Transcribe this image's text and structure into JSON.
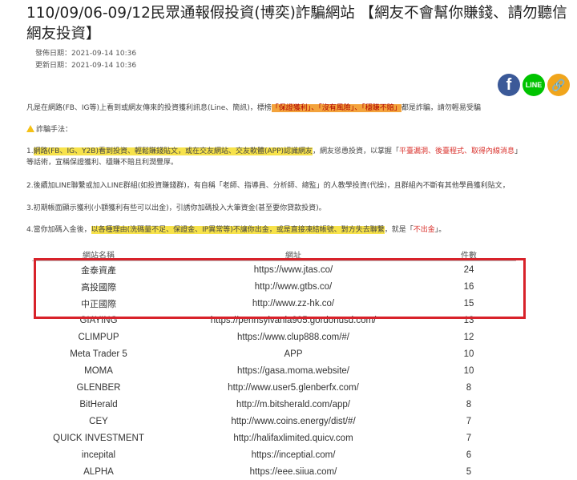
{
  "article": {
    "title": "110/09/06-09/12民眾通報假投資(博奕)詐騙網站 【網友不會幫你賺錢、請勿聽信網友投資】",
    "published": "發佈日期：2021-09-14 10:36",
    "updated": "更新日期：2021-09-14 10:36"
  },
  "share": {
    "facebook": "f",
    "line": "LINE",
    "link": "🔗"
  },
  "intro": {
    "before": "凡是在網路(FB、IG等)上看到或網友傳來的投資獲利訊息(Line、簡訊)，標榜",
    "hl1": "「保證獲利」、「沒有風險」、「穩賺不賠」",
    "after": "都是詐騙，請勿輕易受騙"
  },
  "method_heading": "詐騙手法：",
  "steps": {
    "s1_pre": "1.",
    "s1_hl": "網路(FB、IG、Y2B)看到投資、輕鬆賺錢貼文，或在交友網站、交友軟體(APP)認識網友",
    "s1_mid": "，網友慫恿投資，以掌握「",
    "s1_red": "平臺漏洞、後臺程式、取得內線消息",
    "s1_end": "」",
    "s1_line2": "等話術，宣稱保證獲利、穩賺不賠且利潤豐厚。",
    "s2": "2.後續加LINE聯繫或加入LINE群組(如投資賺錢群)，有自稱「老師、指導員、分析師、總監」的人教學投資(代操)，且群組內不斷有其他學員獲利貼文，",
    "s3": "3.初期帳面顯示獲利(小額獲利有些可以出金)，引誘你加碼投入大筆資金(甚至要你貸款投資)。",
    "s4_pre": "4.當你加碼入金後，",
    "s4_hl": "以各種理由(洗碼量不足、保證金、IP異常等)不讓你出金，或是直接凍結帳號、對方失去聯繫",
    "s4_mid": "，就是「",
    "s4_red": "不出金",
    "s4_end": "」。"
  },
  "table": {
    "headers": [
      "網站名稱",
      "網址",
      "件數"
    ],
    "rows": [
      {
        "name": "金泰資產",
        "url": "https://www.jtas.co/",
        "count": "24"
      },
      {
        "name": "高投國際",
        "url": "http://www.gtbs.co/",
        "count": "16"
      },
      {
        "name": "中正國際",
        "url": "http://www.zz-hk.co/",
        "count": "15"
      },
      {
        "name": "GIAYING",
        "url": "https://pennsylvania905.gordonusd.com/",
        "count": "13"
      },
      {
        "name": "CLIMPUP",
        "url": "https://www.clup888.com/#/",
        "count": "12"
      },
      {
        "name": "Meta Trader 5",
        "url": "APP",
        "count": "10"
      },
      {
        "name": "MOMA",
        "url": "https://gasa.moma.website/",
        "count": "10"
      },
      {
        "name": "GLENBER",
        "url": "http://www.user5.glenberfx.com/",
        "count": "8"
      },
      {
        "name": "BitHerald",
        "url": "http://m.bitsherald.com/app/",
        "count": "8"
      },
      {
        "name": "CEY",
        "url": "http://www.coins.energy/dist/#/",
        "count": "7"
      },
      {
        "name": "QUICK INVESTMENT",
        "url": "http://halifaxlimited.quicv.com",
        "count": "7"
      },
      {
        "name": "incepital",
        "url": "https://inceptial.com/",
        "count": "6"
      },
      {
        "name": "ALPHA",
        "url": "https://eee.siiua.com/",
        "count": "5"
      }
    ]
  },
  "colors": {
    "highlight_orange": "#f3a33c",
    "highlight_yellow": "#f7e24a",
    "warning_red": "#d9302b",
    "box_red": "#d8222a"
  }
}
